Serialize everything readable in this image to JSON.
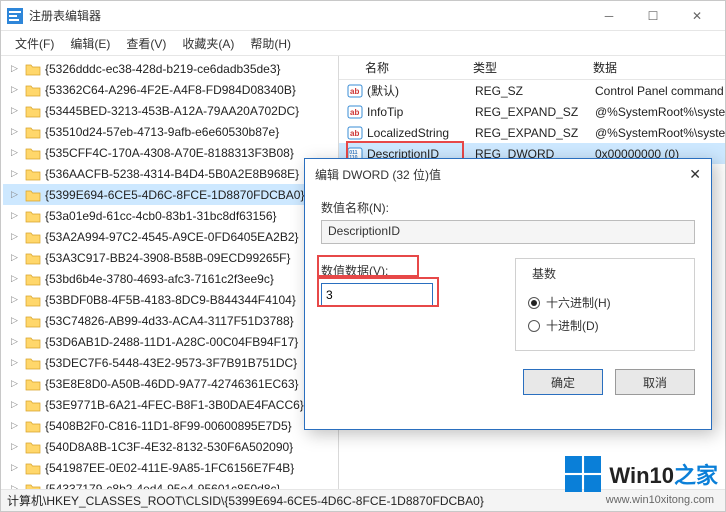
{
  "window": {
    "title": "注册表编辑器",
    "menu": {
      "file": "文件(F)",
      "edit": "编辑(E)",
      "view": "查看(V)",
      "favorites": "收藏夹(A)",
      "help": "帮助(H)"
    }
  },
  "tree": {
    "items": [
      "{5326dddc-ec38-428d-b219-ce6dadb35de3}",
      "{53362C64-A296-4F2E-A4F8-FD984D08340B}",
      "{53445BED-3213-453B-A12A-79AA20A702DC}",
      "{53510d24-57eb-4713-9afb-e6e60530b87e}",
      "{535CFF4C-170A-4308-A70E-8188313F3B08}",
      "{536AACFB-5238-4314-B4D4-5B0A2E8B968E}",
      "{5399E694-6CE5-4D6C-8FCE-1D8870FDCBA0}",
      "{53a01e9d-61cc-4cb0-83b1-31bc8df63156}",
      "{53A2A994-97C2-4545-A9CE-0FD6405EA2B2}",
      "{53A3C917-BB24-3908-B58B-09ECD99265F}",
      "{53bd6b4e-3780-4693-afc3-7161c2f3ee9c}",
      "{53BDF0B8-4F5B-4183-8DC9-B844344F4104}",
      "{53C74826-AB99-4d33-ACA4-3117F51D3788}",
      "{53D6AB1D-2488-11D1-A28C-00C04FB94F17}",
      "{53DEC7F6-5448-43E2-9573-3F7B91B751DC}",
      "{53E8E8D0-A50B-46DD-9A77-42746361EC63}",
      "{53E9771B-6A21-4FEC-B8F1-3B0DAE4FACC6}",
      "{5408B2F0-C816-11D1-8F99-00600895E7D5}",
      "{540D8A8B-1C3F-4E32-8132-530F6A502090}",
      "{541987EE-0E02-411E-9A85-1FC6156E7F4B}",
      "{54337179-c8b2-4ed4-95e4-95601c850d8c}"
    ],
    "selectedIndex": 6
  },
  "values": {
    "columns": {
      "name": "名称",
      "type": "类型",
      "data": "数据"
    },
    "rows": [
      {
        "icon": "string",
        "name": "(默认)",
        "type": "REG_SZ",
        "data": "Control Panel command"
      },
      {
        "icon": "string",
        "name": "InfoTip",
        "type": "REG_EXPAND_SZ",
        "data": "@%SystemRoot%\\syster"
      },
      {
        "icon": "string",
        "name": "LocalizedString",
        "type": "REG_EXPAND_SZ",
        "data": "@%SystemRoot%\\syster"
      },
      {
        "icon": "binary",
        "name": "DescriptionID",
        "type": "REG_DWORD",
        "data": "0x00000000 (0)"
      }
    ],
    "selectedIndex": 3
  },
  "statusbar": "计算机\\HKEY_CLASSES_ROOT\\CLSID\\{5399E694-6CE5-4D6C-8FCE-1D8870FDCBA0}",
  "dialog": {
    "title": "编辑 DWORD (32 位)值",
    "name_label": "数值名称(N):",
    "name_value": "DescriptionID",
    "data_label": "数值数据(V):",
    "data_value": "3",
    "base_label": "基数",
    "radio_hex": "十六进制(H)",
    "radio_dec": "十进制(D)",
    "ok": "确定",
    "cancel": "取消"
  },
  "watermark": {
    "main_a": "Win10",
    "main_b": "之家",
    "sub": "www.win10xitong.com"
  }
}
